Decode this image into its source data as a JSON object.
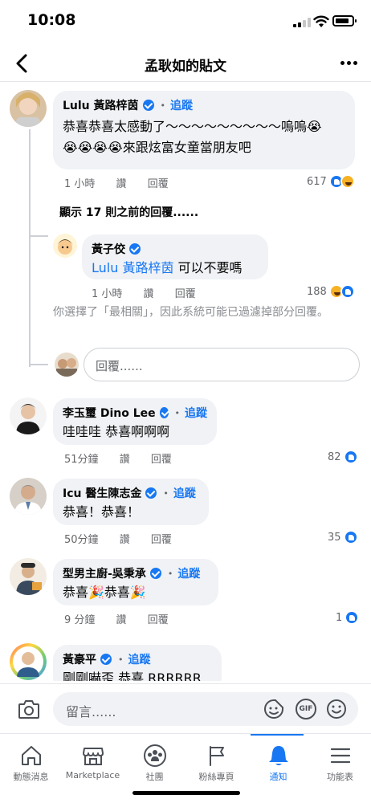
{
  "status_bar": {
    "time": "10:08"
  },
  "header": {
    "title": "孟耿如的貼文"
  },
  "comments": [
    {
      "name": "Lulu 黃路梓茵",
      "follow": "追蹤",
      "text_line1": "恭喜恭喜太感動了～～～～～～～～～嗚嗚😭",
      "text_line2": "😭😭😭😭來跟炫富女童當朋友吧",
      "time": "1 小時",
      "like": "讚",
      "reply": "回覆",
      "reaction_count": "617"
    },
    {
      "name": "黃子佼",
      "mention": "Lulu 黃路梓茵",
      "text": " 可以不要嗎",
      "time": "1 小時",
      "like": "讚",
      "reply": "回覆",
      "reaction_count": "188"
    },
    {
      "name": "李玉璽 Dino Lee",
      "follow": "追蹤",
      "text": "哇哇哇 恭喜啊啊啊",
      "time": "51分鐘",
      "like": "讚",
      "reply": "回覆",
      "reaction_count": "82"
    },
    {
      "name": "Icu 醫生陳志金",
      "follow": "追蹤",
      "text": "恭喜！恭喜！",
      "time": "50分鐘",
      "like": "讚",
      "reply": "回覆",
      "reaction_count": "35"
    },
    {
      "name": "型男主廚-吳秉承",
      "follow": "追蹤",
      "text": "恭喜🎉恭喜🎉",
      "time": "9 分鐘",
      "like": "讚",
      "reply": "回覆",
      "reaction_count": "1"
    },
    {
      "name": "黃豪平",
      "follow": "追蹤",
      "text": "剛剛嚇歪 恭喜 RRRRRR"
    }
  ],
  "thread": {
    "show_more": "顯示 17 則之前的回覆......",
    "filter_notice": "你選擇了「最相關」，因此系統可能已過濾掉部分回覆。",
    "reply_placeholder": "回覆......"
  },
  "composer": {
    "placeholder": "留言......",
    "gif_label": "GIF"
  },
  "tabs": [
    {
      "label": "動態消息",
      "icon": "home-icon"
    },
    {
      "label": "Marketplace",
      "icon": "marketplace-icon"
    },
    {
      "label": "社團",
      "icon": "groups-icon"
    },
    {
      "label": "粉絲專頁",
      "icon": "flag-icon"
    },
    {
      "label": "通知",
      "icon": "bell-icon",
      "active": true
    },
    {
      "label": "功能表",
      "icon": "menu-icon"
    }
  ],
  "colors": {
    "accent": "#1877f2",
    "bubble": "#f0f2f5",
    "muted": "#65676b",
    "haha": "#f7b125"
  }
}
